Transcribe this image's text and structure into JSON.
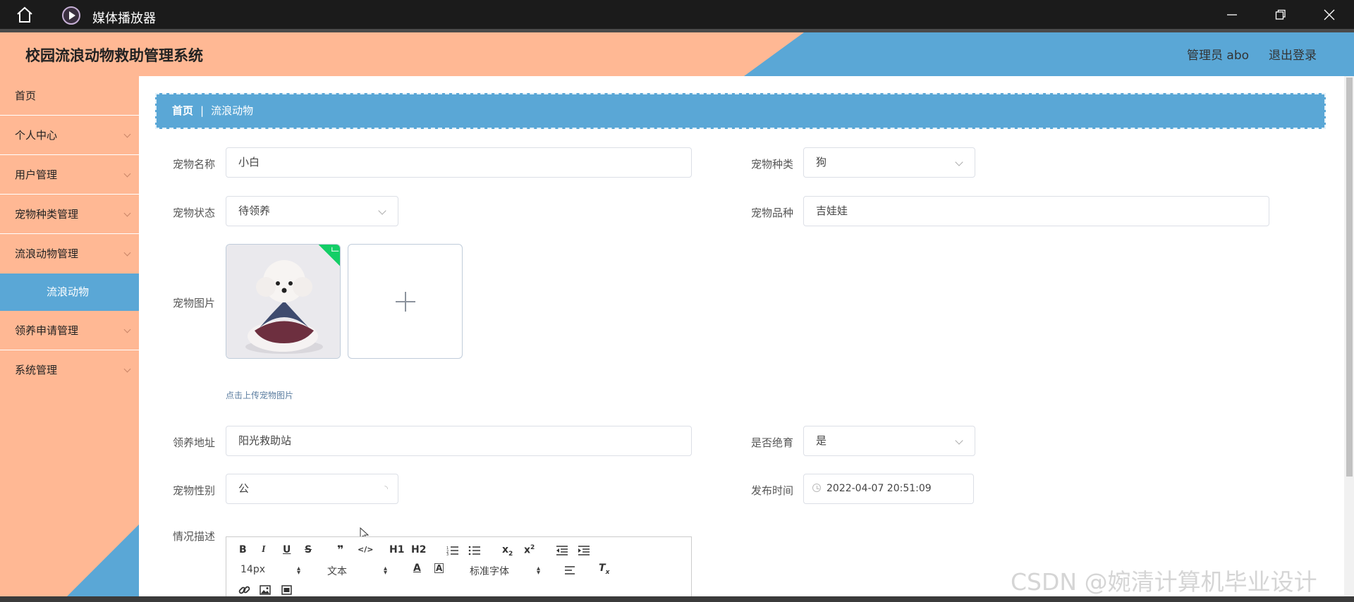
{
  "window": {
    "title": "媒体播放器",
    "icons": [
      "home-icon",
      "media-player-icon",
      "minimize-icon",
      "restore-icon",
      "close-icon"
    ]
  },
  "header": {
    "system_name": "校园流浪动物救助管理系统",
    "admin_label": "管理员 abo",
    "logout_label": "退出登录"
  },
  "sidebar": {
    "items": [
      {
        "label": "首页"
      },
      {
        "label": "个人中心"
      },
      {
        "label": "用户管理"
      },
      {
        "label": "宠物种类管理"
      },
      {
        "label": "流浪动物管理"
      },
      {
        "label": "流浪动物"
      },
      {
        "label": "领养申请管理"
      },
      {
        "label": "系统管理"
      }
    ]
  },
  "breadcrumb": {
    "home": "首页",
    "separator": "|",
    "current": "流浪动物"
  },
  "form": {
    "pet_name": {
      "label": "宠物名称",
      "value": "小白"
    },
    "pet_category": {
      "label": "宠物种类",
      "value": "狗"
    },
    "pet_status": {
      "label": "宠物状态",
      "value": "待领养"
    },
    "pet_breed": {
      "label": "宠物品种",
      "value": "吉娃娃"
    },
    "pet_image": {
      "label": "宠物图片",
      "tip": "点击上传宠物图片"
    },
    "adopt_address": {
      "label": "领养地址",
      "value": "阳光救助站"
    },
    "neutered": {
      "label": "是否绝育",
      "value": "是"
    },
    "pet_gender": {
      "label": "宠物性别",
      "value": "公"
    },
    "publish_time": {
      "label": "发布时间",
      "value": "2022-04-07 20:51:09"
    },
    "description": {
      "label": "情况描述"
    }
  },
  "editor_toolbar": {
    "bold": "B",
    "italic": "I",
    "underline": "U",
    "strike": "S",
    "blockquote": "❞",
    "code": "</>",
    "h1": "H1",
    "h2": "H2",
    "font_size": "14px",
    "text_type": "文本",
    "font_family": "标准字体"
  },
  "watermark": "CSDN @婉清计算机毕业设计",
  "colors": {
    "peach": "#ffb894",
    "blue": "#5aa7d6",
    "titlebar": "#1b1b1b",
    "success": "#13ce66"
  }
}
